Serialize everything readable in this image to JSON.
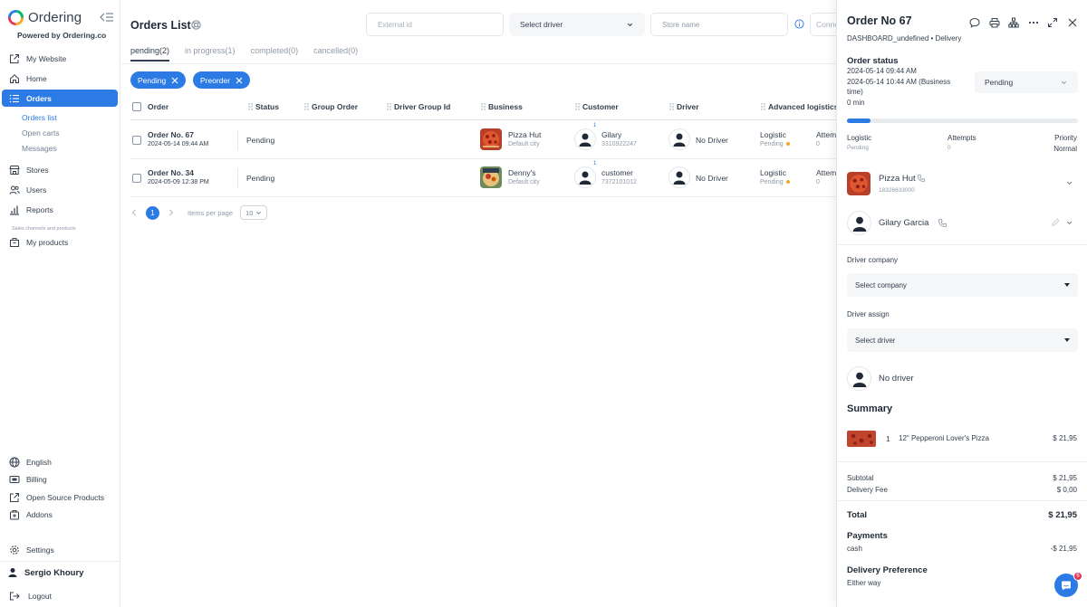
{
  "brand": {
    "name": "Ordering",
    "powered": "Powered by Ordering.co"
  },
  "sidebar": {
    "items": [
      {
        "label": "My Website",
        "icon": "external-link-icon"
      },
      {
        "label": "Home",
        "icon": "home-icon"
      },
      {
        "label": "Orders",
        "icon": "list-icon"
      },
      {
        "label": "Stores",
        "icon": "shop-icon"
      },
      {
        "label": "Users",
        "icon": "users-icon"
      },
      {
        "label": "Reports",
        "icon": "bar-chart-icon"
      },
      {
        "label": "My products",
        "icon": "box-icon"
      }
    ],
    "orders_sub": [
      "Orders list",
      "Open carts",
      "Messages"
    ],
    "section_label": "Sales channels and products",
    "bottom": [
      {
        "label": "English",
        "icon": "globe-icon"
      },
      {
        "label": "Billing",
        "icon": "billing-icon"
      },
      {
        "label": "Open Source Products",
        "icon": "external-link-icon"
      },
      {
        "label": "Addons",
        "icon": "addons-icon"
      },
      {
        "label": "Settings",
        "icon": "gear-icon"
      }
    ],
    "user": "Sergio Khoury",
    "logout": "Logout"
  },
  "main": {
    "title": "Orders List",
    "filters": {
      "external_id_placeholder": "External id",
      "driver_select": "Select driver",
      "store_placeholder": "Store name",
      "connect": "Conne"
    },
    "tabs": [
      "pending(2)",
      "in progress(1)",
      "completed(0)",
      "cancelled(0)"
    ],
    "chips": [
      "Pending",
      "Preorder"
    ],
    "columns": [
      "Order",
      "Status",
      "Group Order",
      "Driver Group Id",
      "Business",
      "Customer",
      "Driver",
      "Advanced logistics"
    ],
    "rows": [
      {
        "order": "Order No. 67",
        "date": "2024-05-14 09:44 AM",
        "status": "Pending",
        "business": "Pizza Hut",
        "city": "Default city",
        "customer": "Gilary",
        "phone": "3310922247",
        "badge": "1",
        "driver": "No Driver",
        "logistic": "Logistic",
        "logistic_status": "Pending",
        "attempts_label": "Attem",
        "attempts": "0"
      },
      {
        "order": "Order No. 34",
        "date": "2024-05-09 12:38 PM",
        "status": "Pending",
        "business": "Denny's",
        "city": "Default city",
        "customer": "customer",
        "phone": "7372101012",
        "badge": "1",
        "driver": "No Driver",
        "logistic": "Logistic",
        "logistic_status": "Pending",
        "attempts_label": "Attem",
        "attempts": "0"
      }
    ],
    "pagination": {
      "page": "1",
      "items_per_page_label": "Items per page",
      "items_per_page": "10"
    }
  },
  "panel": {
    "title": "Order No 67",
    "subtitle": "DASHBOARD_undefined • Delivery",
    "status_heading": "Order status",
    "date1": "2024-05-14 09:44 AM",
    "date2": "2024-05-14 10:44 AM (Business",
    "date2b": "time)",
    "elapsed": "0 min",
    "status_value": "Pending",
    "progress_fraction": 0.1,
    "logistic_label": "Logistic",
    "logistic_value": "Pending",
    "attempts_label": "Attempts",
    "attempts_value": "0",
    "priority_label": "Priority",
    "priority_value": "Normal",
    "business_name": "Pizza Hut",
    "business_phone": "18326633000",
    "customer_name": "Gilary Garcia",
    "driver_company_label": "Driver company",
    "driver_company_placeholder": "Select company",
    "driver_assign_label": "Driver assign",
    "driver_assign_placeholder": "Select driver",
    "no_driver": "No driver",
    "summary_heading": "Summary",
    "item_qty": "1",
    "item_name": "12\" Pepperoni Lover's Pizza",
    "item_price": "$ 21,95",
    "subtotal_label": "Subtotal",
    "subtotal": "$ 21,95",
    "delivery_fee_label": "Delivery Fee",
    "delivery_fee": "$ 0,00",
    "total_label": "Total",
    "total": "$ 21,95",
    "payments_heading": "Payments",
    "payment_method": "cash",
    "payment_amount": "-$ 21,95",
    "delivery_pref_heading": "Delivery Preference",
    "delivery_pref": "Either way",
    "help_badge": "6"
  }
}
